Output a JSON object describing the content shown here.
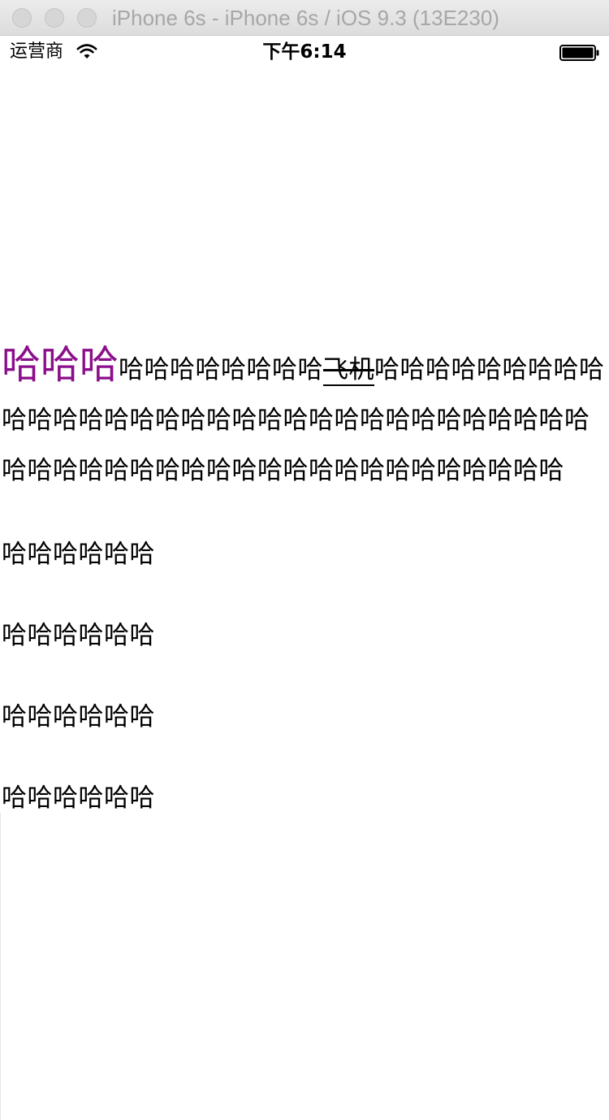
{
  "window": {
    "title": "iPhone 6s - iPhone 6s / iOS 9.3 (13E230)"
  },
  "status_bar": {
    "carrier": "运营商",
    "time": "下午6:14",
    "wifi_icon": "wifi-icon",
    "battery_icon": "battery-icon"
  },
  "text_view": {
    "highlight": "哈哈哈",
    "highlight_color": "#8b0f8b",
    "run_before_link": "哈哈哈哈哈哈哈哈",
    "link_text": "飞机",
    "run_after_link": "哈哈哈哈哈哈哈哈哈哈哈哈哈哈哈哈哈哈哈哈哈哈哈哈哈哈哈哈哈哈哈哈哈哈哈哈哈哈哈哈哈哈哈哈哈哈哈哈哈哈哈哈哈哈"
  },
  "lines": [
    "哈哈哈哈哈哈",
    "哈哈哈哈哈哈",
    "哈哈哈哈哈哈",
    "哈哈哈哈哈哈"
  ]
}
